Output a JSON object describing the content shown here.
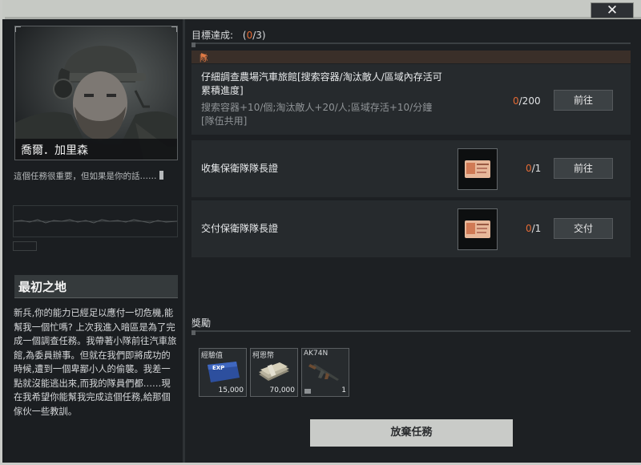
{
  "window": {
    "close_glyph": "✕"
  },
  "npc": {
    "name": "喬爾．加里森",
    "quote": "這個任務很重要，但如果是你的話……"
  },
  "story": {
    "title": "最初之地",
    "text": "新兵,你的能力已經足以應付一切危機,能幫我一個忙嗎? 上次我進入暗區是為了完成一個調查任務。我帶著小隊前往汽車旅館,為委員辦事。但就在我們即將成功的時候,遭到一個卑鄙小人的偷襲。我差一點就沒能逃出來,而我的隊員們都……現在我希望你能幫我完成這個任務,給那個傢伙一些教訓。"
  },
  "objectives": {
    "label": "目標達成:",
    "open": "(",
    "done": "0",
    "rest": "/3)",
    "squad_tag": "隊伍共用",
    "tasks": [
      {
        "title": "仔細調查農場汽車旅館[搜索容器/淘汰敵人/區域內存活可累積進度]",
        "detail": "搜索容器+10/個;淘汰敵人+20/人;區域存活+10/分鐘[隊伍共用]",
        "progress_cur": "0",
        "progress_total": "/200",
        "button": "前往"
      },
      {
        "title": "收集保衛隊隊長證",
        "progress_cur": "0",
        "progress_total": "/1",
        "button": "前往"
      },
      {
        "title": "交付保衛隊隊長證",
        "progress_cur": "0",
        "progress_total": "/1",
        "button": "交付"
      }
    ]
  },
  "rewards": {
    "label": "獎勵",
    "items": [
      {
        "name": "經驗值",
        "count": "15,000",
        "icon": "exp-card-icon",
        "badge": "EXP"
      },
      {
        "name": "柯恩幣",
        "count": "70,000",
        "icon": "cash-stack-icon"
      },
      {
        "name": "AK74N",
        "count": "1",
        "icon": "rifle-icon"
      }
    ]
  },
  "actions": {
    "abandon": "放棄任務"
  },
  "colors": {
    "accent": "#e36a35",
    "panel": "#262a2d",
    "frame": "#c9cbc7"
  }
}
